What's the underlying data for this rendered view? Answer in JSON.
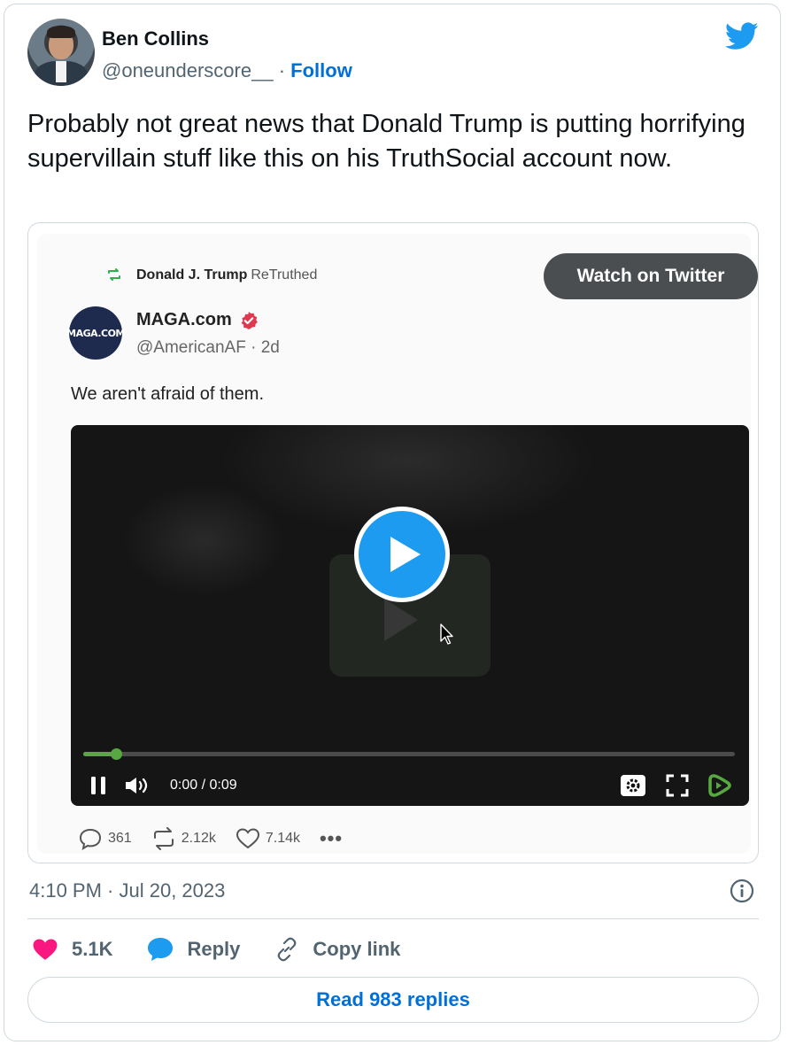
{
  "tweet": {
    "author_name": "Ben Collins",
    "author_handle": "@oneunderscore__",
    "separator": "·",
    "follow_label": "Follow",
    "text": "Probably not great news that Donald Trump is putting horrifying supervillain stuff like this on his TruthSocial account now.",
    "timestamp": "4:10 PM · Jul 20, 2023",
    "like_count": "5.1K",
    "reply_label": "Reply",
    "copy_link_label": "Copy link",
    "read_replies_label": "Read 983 replies"
  },
  "embed": {
    "retruth_user": "Donald J. Trump",
    "retruth_label": "ReTruthed",
    "watch_label": "Watch on Twitter",
    "avatar_text": "MAGA.COM",
    "name": "MAGA.com",
    "handle_line": "@AmericanAF · 2d",
    "text": "We aren't afraid of them.",
    "video": {
      "time": "0:00 / 0:09",
      "progress": 0.05
    },
    "stats": {
      "replies": "361",
      "retruths": "2.12k",
      "likes": "7.14k"
    }
  },
  "colors": {
    "twitter_blue": "#1d9bf0",
    "link_blue": "#006fd6",
    "like_pink": "#f91880",
    "rumble_green": "#57a840",
    "retruth_green": "#2bb24c",
    "verified_red": "#e0394f"
  },
  "icons": [
    "twitter-logo-icon",
    "retruth-icon",
    "verified-icon",
    "play-icon",
    "pause-icon",
    "volume-icon",
    "gear-icon",
    "fullscreen-icon",
    "rumble-icon",
    "comment-icon",
    "repost-icon",
    "heart-icon",
    "more-icon",
    "info-icon",
    "reply-bubble-icon",
    "link-icon"
  ]
}
